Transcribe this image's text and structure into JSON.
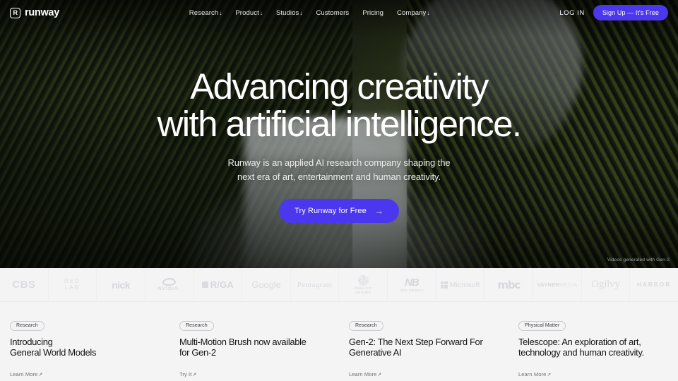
{
  "brand": {
    "mark": "runway-logo-icon",
    "name": "runway"
  },
  "nav": {
    "links": [
      {
        "label": "Research",
        "caret": "↓"
      },
      {
        "label": "Product",
        "caret": "↓"
      },
      {
        "label": "Studios",
        "caret": "↓"
      },
      {
        "label": "Customers",
        "caret": ""
      },
      {
        "label": "Pricing",
        "caret": ""
      },
      {
        "label": "Company",
        "caret": "↓"
      }
    ],
    "login_label": "LOG IN",
    "signup_label": "Sign Up — It's Free",
    "signup_color": "#4b37ee"
  },
  "hero": {
    "headline_line1": "Advancing creativity",
    "headline_line2": "with artificial intelligence.",
    "subhead_line1": "Runway is an applied AI research company shaping the",
    "subhead_line2": "next era of art, entertainment and human creativity.",
    "cta_label": "Try Runway for Free",
    "cta_arrow": "→",
    "cta_color": "#4b37ee",
    "video_credit": "Videos generated with Gen-2"
  },
  "logos": [
    {
      "name": "CBS"
    },
    {
      "name": "RED LAB",
      "line1": "RED",
      "line2": "LAB"
    },
    {
      "name": "nick"
    },
    {
      "name": "NVIDIA",
      "word": "NVIDIA."
    },
    {
      "name": "R/GA",
      "word": "R/GA"
    },
    {
      "name": "Google"
    },
    {
      "name": "Pentagram"
    },
    {
      "name": "PUBLICIS GROUPE",
      "line1": "PUBLICIS",
      "line2": "GROUPE"
    },
    {
      "name": "new balance",
      "mark": "NB",
      "word": "new balance"
    },
    {
      "name": "Microsoft"
    },
    {
      "name": "mbc"
    },
    {
      "name": "VAYNERMEDIA",
      "bold": "VAYNER",
      "light": "MEDIA"
    },
    {
      "name": "Ogilvy"
    },
    {
      "name": "HARBOR"
    }
  ],
  "cards": [
    {
      "tag": "Research",
      "title_line1": "Introducing",
      "title_line2": "General World Models",
      "link": "Learn More",
      "link_arrow": "↗"
    },
    {
      "tag": "Research",
      "title_line1": "Multi-Motion Brush now available",
      "title_line2": "for Gen-2",
      "link": "Try It",
      "link_arrow": "↗"
    },
    {
      "tag": "Research",
      "title_line1": "Gen-2: The Next Step Forward For",
      "title_line2": "Generative AI",
      "link": "Learn More",
      "link_arrow": "↗"
    },
    {
      "tag": "Physical Matter",
      "title_line1": "Telescope: An exploration of art,",
      "title_line2": "technology and human creativity.",
      "link": "Learn More",
      "link_arrow": "↗"
    }
  ]
}
